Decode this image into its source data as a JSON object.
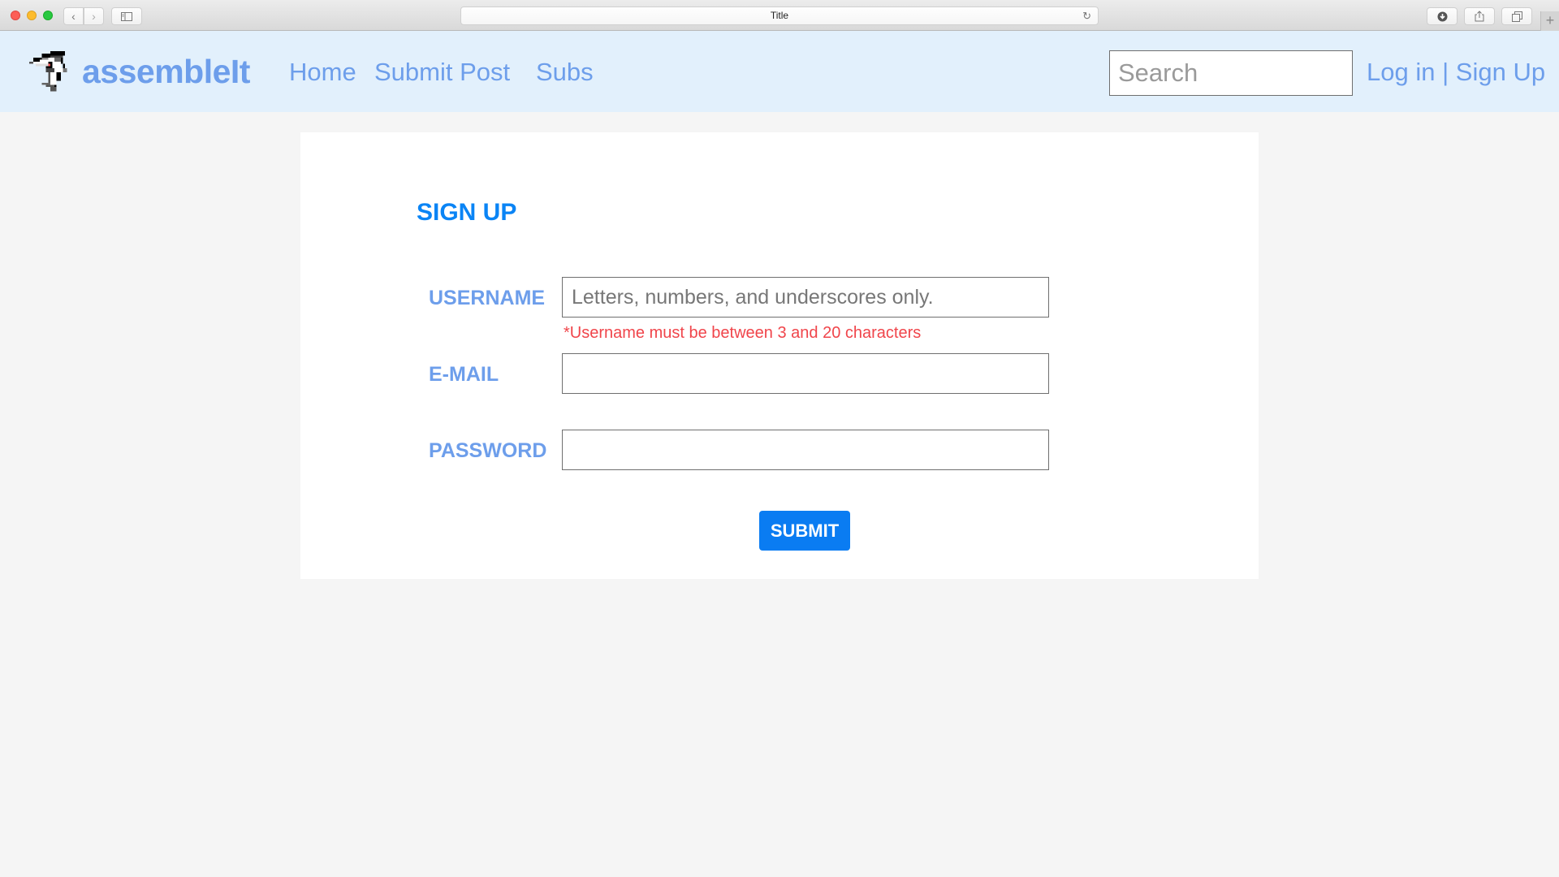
{
  "browser": {
    "tab_title": "Title",
    "icons": {
      "back": "chevron-left-icon",
      "forward": "chevron-right-icon",
      "sidebar": "sidebar-icon",
      "reload": "reload-icon",
      "downloads": "download-icon",
      "share": "share-icon",
      "tabs": "tabs-overview-icon",
      "new_tab": "plus-icon"
    },
    "back_glyph": "‹",
    "forward_glyph": "›",
    "reload_glyph": "↻",
    "new_tab_glyph": "+"
  },
  "header": {
    "brand": "assembleIt",
    "nav": [
      {
        "label": "Home"
      },
      {
        "label": "Submit Post"
      },
      {
        "label": "Subs"
      }
    ],
    "search_placeholder": "Search",
    "login_label": "Log in",
    "separator": "|",
    "signup_label": "Sign Up"
  },
  "form": {
    "title": "SIGN UP",
    "fields": {
      "username": {
        "label": "USERNAME",
        "placeholder": "Letters, numbers, and underscores only.",
        "value": "",
        "error": "*Username must be between 3 and 20 characters"
      },
      "email": {
        "label": "E-MAIL",
        "placeholder": "",
        "value": ""
      },
      "password": {
        "label": "PASSWORD",
        "placeholder": "",
        "value": ""
      }
    },
    "submit_label": "SUBMIT"
  },
  "colors": {
    "header_bg": "#e2f0fc",
    "link": "#6d9eeb",
    "title": "#0a84f5",
    "button": "#0a7cf2",
    "error": "#f0454b",
    "page_bg": "#f5f5f5"
  }
}
